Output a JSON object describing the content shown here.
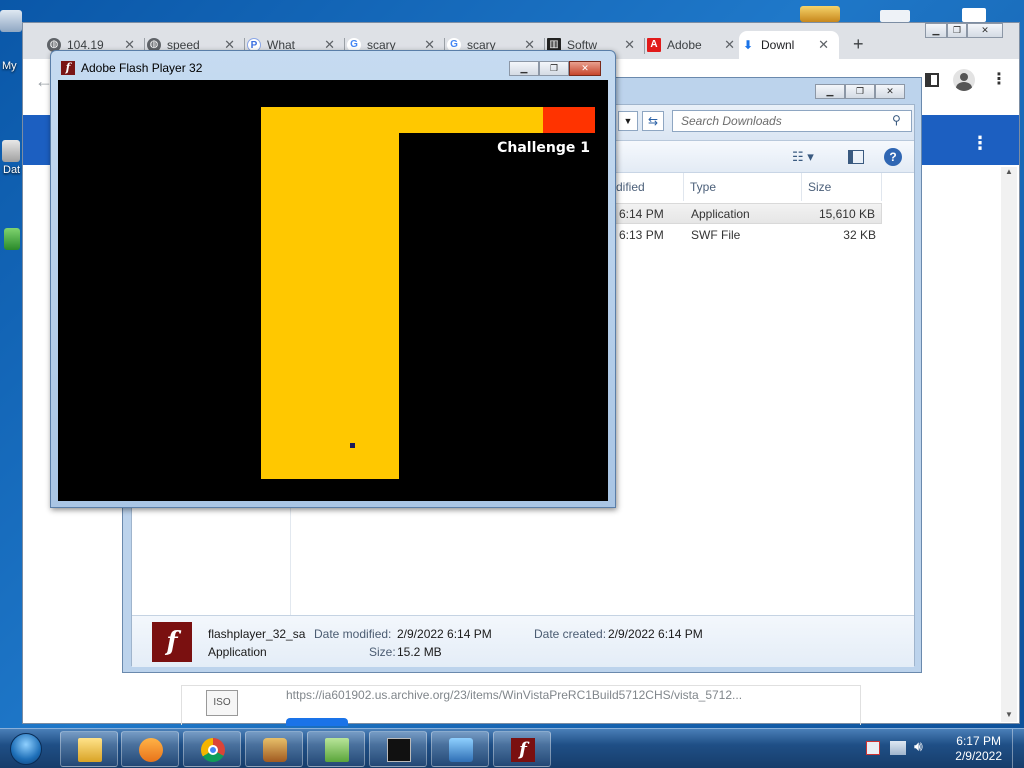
{
  "desktop": {
    "labels": [
      "My",
      "Dat"
    ]
  },
  "browser": {
    "tabs": [
      {
        "title": "104.19",
        "icon": "globe-icon"
      },
      {
        "title": "speed",
        "icon": "globe-icon"
      },
      {
        "title": "What",
        "icon": "perplexity-icon"
      },
      {
        "title": "scary",
        "icon": "google-icon"
      },
      {
        "title": "scary",
        "icon": "google-icon"
      },
      {
        "title": "Softw",
        "icon": "archive-icon"
      },
      {
        "title": "Adobe",
        "icon": "adobe-icon"
      },
      {
        "title": "Downl",
        "icon": "download-icon"
      }
    ],
    "new_tab": "+",
    "download_url": "https://ia601902.us.archive.org/23/items/WinVistaPreRC1Build5712CHS/vista_5712...",
    "download_file_icon": "ISO"
  },
  "explorer": {
    "search_placeholder": "Search Downloads",
    "columns": {
      "modified": "dified",
      "type": "Type",
      "size": "Size"
    },
    "files": [
      {
        "modified": "6:14 PM",
        "type": "Application",
        "size": "15,610 KB"
      },
      {
        "modified": "6:13 PM",
        "type": "SWF File",
        "size": "32 KB"
      }
    ],
    "details": {
      "name": "flashplayer_32_sa",
      "kind": "Application",
      "date_modified_label": "Date modified:",
      "date_modified": "2/9/2022 6:14 PM",
      "date_created_label": "Date created:",
      "date_created": "2/9/2022 6:14 PM",
      "size_label": "Size:",
      "size": "15.2 MB"
    }
  },
  "flash": {
    "title": "Adobe Flash Player 32",
    "challenge": "Challenge 1",
    "colors": {
      "path": "#ffc800",
      "goal": "#ff3300",
      "background": "#000000",
      "cursor": "#1a1a5a"
    }
  },
  "taskbar": {
    "apps": [
      "explorer-icon",
      "media-player-icon",
      "chrome-icon",
      "game-icon",
      "notepad-plus-icon",
      "cmd-icon",
      "network-icon",
      "flash-icon"
    ],
    "time": "6:17 PM",
    "date": "2/9/2022"
  }
}
